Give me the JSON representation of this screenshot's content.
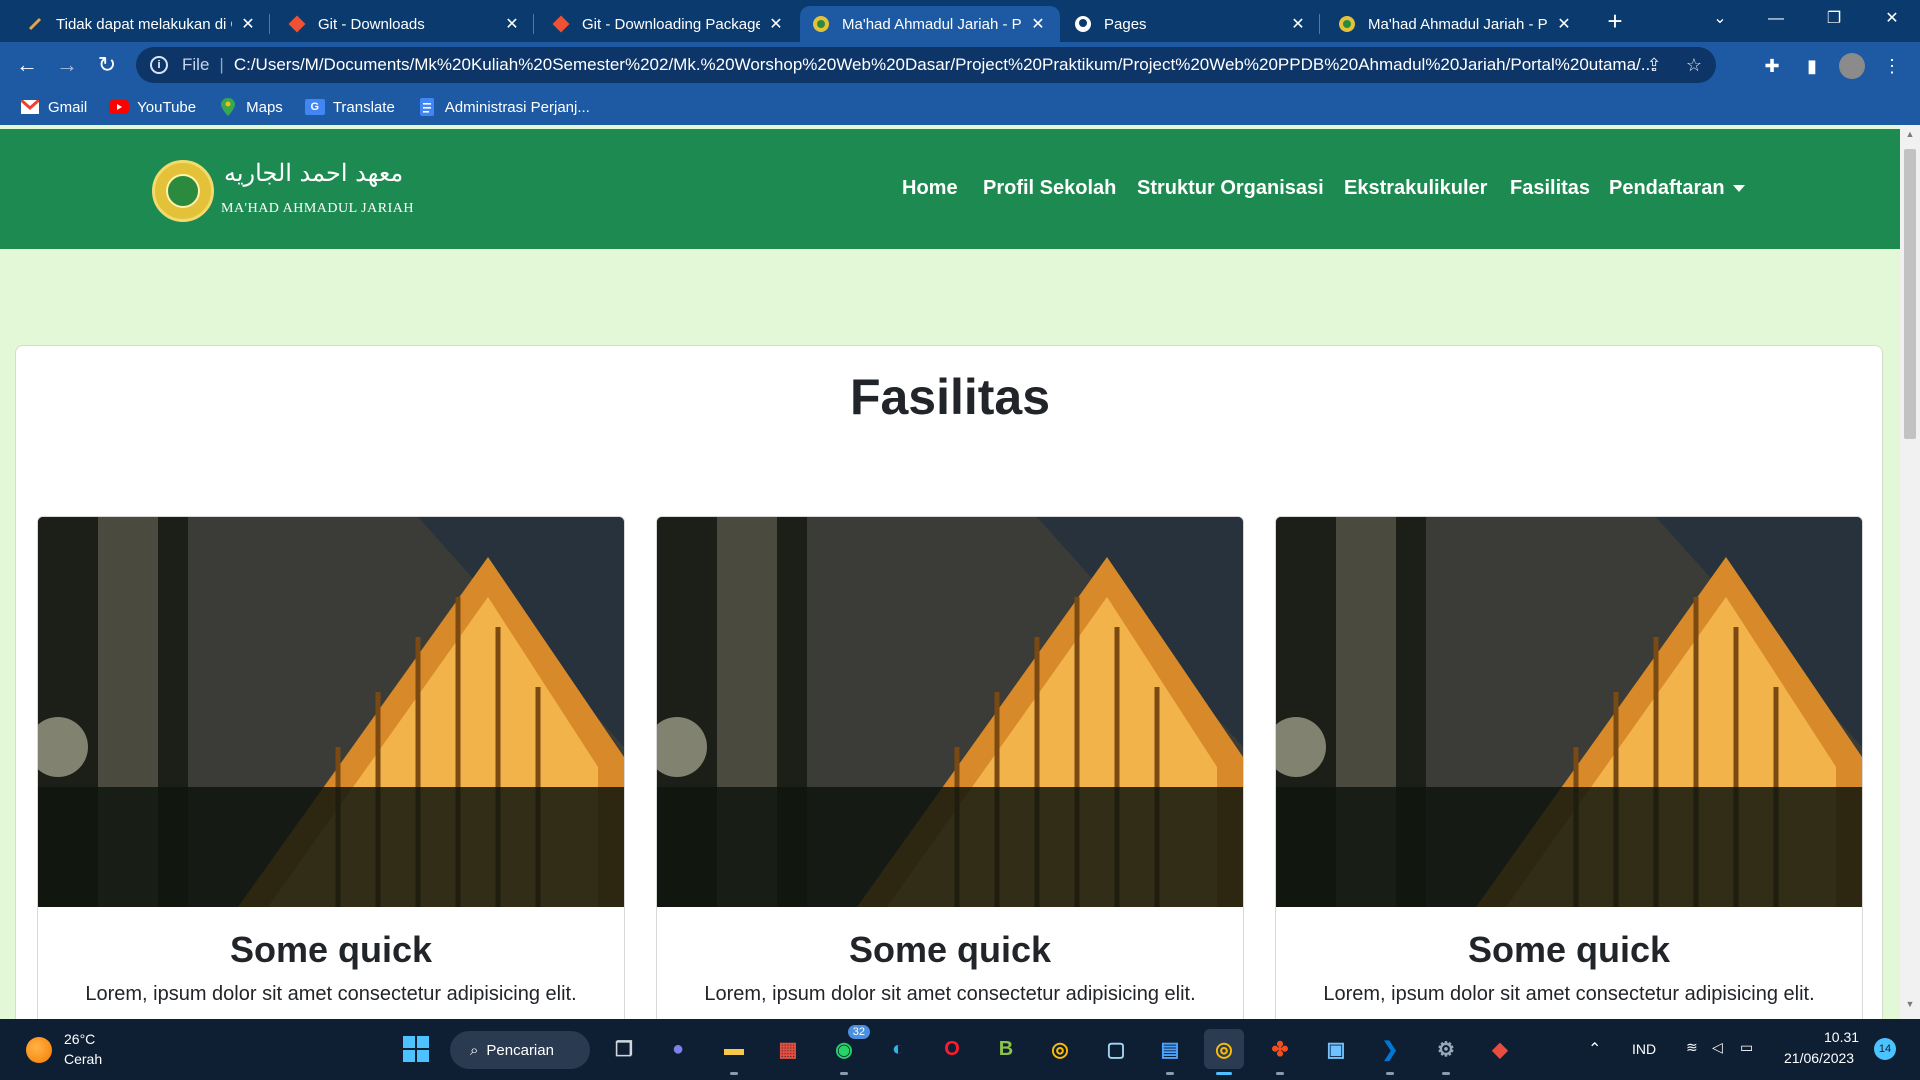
{
  "browser": {
    "tabs": [
      {
        "title": "Tidak dapat melakukan di G",
        "favicon": "document-icon",
        "active": false
      },
      {
        "title": "Git - Downloads",
        "favicon": "git-icon",
        "active": false
      },
      {
        "title": "Git - Downloading Package",
        "favicon": "git-icon",
        "active": false
      },
      {
        "title": "Ma'had Ahmadul Jariah - Po",
        "favicon": "school-logo-icon",
        "active": true
      },
      {
        "title": "Pages",
        "favicon": "github-icon",
        "active": false
      },
      {
        "title": "Ma'had Ahmadul Jariah - Po",
        "favicon": "school-logo-icon",
        "active": false
      }
    ],
    "address": {
      "scheme_label": "File",
      "url": "C:/Users/M/Documents/Mk%20Kuliah%20Semester%202/Mk.%20Worshop%20Web%20Dasar/Project%20Praktikum/Project%20Web%20PPDB%20Ahmadul%20Jariah/Portal%20utama/..."
    },
    "bookmarks": [
      {
        "label": "Gmail",
        "icon": "gmail-icon",
        "color": "#ea4335"
      },
      {
        "label": "YouTube",
        "icon": "youtube-icon",
        "color": "#ff0000"
      },
      {
        "label": "Maps",
        "icon": "maps-icon",
        "color": "#34a853"
      },
      {
        "label": "Translate",
        "icon": "translate-icon",
        "color": "#4285f4"
      },
      {
        "label": "Administrasi Perjanj...",
        "icon": "docs-icon",
        "color": "#4285f4"
      }
    ]
  },
  "site": {
    "brand_arabic": "معهد احمد الجاريه",
    "brand_latin": "MA'HAD AHMADUL JARIAH",
    "nav": [
      "Home",
      "Profil Sekolah",
      "Struktur Organisasi",
      "Ekstrakulikuler",
      "Fasilitas",
      "Pendaftaran"
    ],
    "section_title": "Fasilitas",
    "cards": [
      {
        "title": "Some quick",
        "text": "Lorem, ipsum dolor sit amet consectetur adipisicing elit."
      },
      {
        "title": "Some quick",
        "text": "Lorem, ipsum dolor sit amet consectetur adipisicing elit."
      },
      {
        "title": "Some quick",
        "text": "Lorem, ipsum dolor sit amet consectetur adipisicing elit."
      }
    ],
    "colors": {
      "navbar": "#1d8a51",
      "page_bg": "#e3f8d6"
    }
  },
  "taskbar": {
    "weather": {
      "temp": "26°C",
      "condition": "Cerah"
    },
    "search_label": "Pencarian",
    "whatsapp_badge": "32",
    "lang": "IND",
    "time": "10.31",
    "date": "21/06/2023",
    "notifications": "14"
  }
}
